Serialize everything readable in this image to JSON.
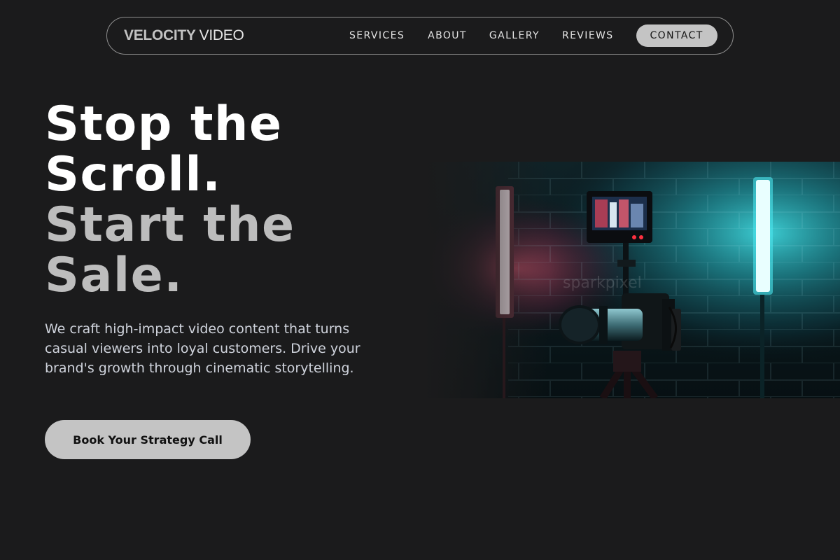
{
  "nav": {
    "logo_bold": "VELOCITY",
    "logo_light": "VIDEO",
    "links": [
      "SERVICES",
      "ABOUT",
      "GALLERY",
      "REVIEWS"
    ],
    "contact_label": "CONTACT"
  },
  "hero": {
    "headline_line1": "Stop the",
    "headline_line2": "Scroll.",
    "headline_line3": "Start the",
    "headline_line4": "Sale.",
    "subtext": "We craft high-impact video content that turns casual viewers into loyal customers. Drive your brand's growth through cinematic storytelling.",
    "cta_label": "Book Your Strategy Call",
    "image_watermark": "sparkpixel"
  },
  "colors": {
    "background": "#1b1b1c",
    "accent_button": "#c4c4c4",
    "teal_light": "#5ff3f7",
    "pink_light": "#ff6b7d"
  }
}
